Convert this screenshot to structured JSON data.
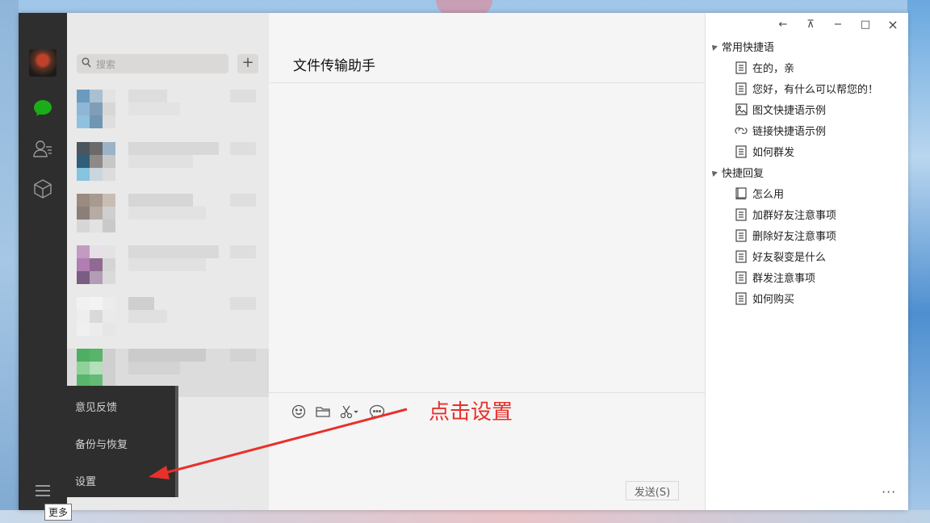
{
  "sidebar": {
    "search_placeholder": "搜索",
    "add_symbol": "+",
    "menu_items": [
      "意见反馈",
      "备份与恢复",
      "设置"
    ],
    "more_tooltip": "更多"
  },
  "chat": {
    "title": "文件传输助手",
    "send_label": "发送(S)"
  },
  "annotation": {
    "text": "点击设置",
    "color": "#e8302a"
  },
  "quick_phrases": {
    "window_controls": [
      "←",
      "⊼",
      "−",
      "□",
      "×"
    ],
    "groups": [
      {
        "title": "常用快捷语",
        "items": [
          {
            "label": "在的，亲",
            "icon": "document-icon"
          },
          {
            "label": "您好，有什么可以帮您的！",
            "icon": "document-icon"
          },
          {
            "label": "图文快捷语示例",
            "icon": "image-icon"
          },
          {
            "label": "链接快捷语示例",
            "icon": "link-icon"
          },
          {
            "label": "如何群发",
            "icon": "document-icon"
          }
        ]
      },
      {
        "title": "快捷回复",
        "items": [
          {
            "label": "怎么用",
            "icon": "book-icon"
          },
          {
            "label": "加群好友注意事项",
            "icon": "document-icon"
          },
          {
            "label": "删除好友注意事项",
            "icon": "document-icon"
          },
          {
            "label": "好友裂变是什么",
            "icon": "document-icon"
          },
          {
            "label": "群发注意事项",
            "icon": "document-icon"
          },
          {
            "label": "如何购买",
            "icon": "document-icon"
          }
        ]
      }
    ],
    "more": "···"
  },
  "colors": {
    "nav_bg": "#2e2e2e",
    "chat_icon_green": "#1aad19"
  }
}
